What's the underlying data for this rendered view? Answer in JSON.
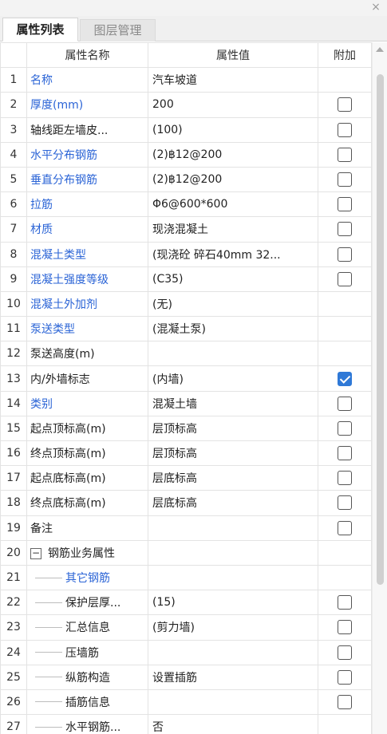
{
  "tabs": [
    {
      "label": "属性列表",
      "active": true
    },
    {
      "label": "图层管理",
      "active": false
    }
  ],
  "close_glyph": "×",
  "columns": {
    "name": "属性名称",
    "value": "属性值",
    "add": "附加"
  },
  "rows": [
    {
      "idx": "1",
      "name": "名称",
      "value": "汽车坡道",
      "blue": true,
      "checkbox": false,
      "checked": false
    },
    {
      "idx": "2",
      "name": "厚度(mm)",
      "value": "200",
      "blue": true,
      "checkbox": true,
      "checked": false
    },
    {
      "idx": "3",
      "name": "轴线距左墙皮...",
      "value": "(100)",
      "blue": false,
      "checkbox": true,
      "checked": false
    },
    {
      "idx": "4",
      "name": "水平分布钢筋",
      "value": "(2)฿12@200",
      "blue": true,
      "checkbox": true,
      "checked": false
    },
    {
      "idx": "5",
      "name": "垂直分布钢筋",
      "value": "(2)฿12@200",
      "blue": true,
      "checkbox": true,
      "checked": false
    },
    {
      "idx": "6",
      "name": "拉筋",
      "value": "Φ6@600*600",
      "blue": true,
      "checkbox": true,
      "checked": false
    },
    {
      "idx": "7",
      "name": "材质",
      "value": "现浇混凝土",
      "blue": true,
      "checkbox": true,
      "checked": false
    },
    {
      "idx": "8",
      "name": "混凝土类型",
      "value": "(现浇砼 碎石40mm 32...",
      "blue": true,
      "checkbox": true,
      "checked": false
    },
    {
      "idx": "9",
      "name": "混凝土强度等级",
      "value": "(C35)",
      "blue": true,
      "checkbox": true,
      "checked": false
    },
    {
      "idx": "10",
      "name": "混凝土外加剂",
      "value": "(无)",
      "blue": true,
      "checkbox": false,
      "checked": false
    },
    {
      "idx": "11",
      "name": "泵送类型",
      "value": "(混凝土泵)",
      "blue": true,
      "checkbox": false,
      "checked": false
    },
    {
      "idx": "12",
      "name": "泵送高度(m)",
      "value": "",
      "blue": false,
      "checkbox": false,
      "checked": false
    },
    {
      "idx": "13",
      "name": "内/外墙标志",
      "value": "(内墙)",
      "blue": false,
      "checkbox": true,
      "checked": true
    },
    {
      "idx": "14",
      "name": "类别",
      "value": "混凝土墙",
      "blue": true,
      "checkbox": true,
      "checked": false
    },
    {
      "idx": "15",
      "name": "起点顶标高(m)",
      "value": "层顶标高",
      "blue": false,
      "checkbox": true,
      "checked": false
    },
    {
      "idx": "16",
      "name": "终点顶标高(m)",
      "value": "层顶标高",
      "blue": false,
      "checkbox": true,
      "checked": false
    },
    {
      "idx": "17",
      "name": "起点底标高(m)",
      "value": "层底标高",
      "blue": false,
      "checkbox": true,
      "checked": false
    },
    {
      "idx": "18",
      "name": "终点底标高(m)",
      "value": "层底标高",
      "blue": false,
      "checkbox": true,
      "checked": false
    },
    {
      "idx": "19",
      "name": "备注",
      "value": "",
      "blue": false,
      "checkbox": true,
      "checked": false
    }
  ],
  "group": {
    "idx": "20",
    "toggle": "−",
    "name": "钢筋业务属性"
  },
  "child_rows": [
    {
      "idx": "21",
      "name": "其它钢筋",
      "value": "",
      "blue": true,
      "checkbox": false,
      "checked": false
    },
    {
      "idx": "22",
      "name": "保护层厚...",
      "value": "(15)",
      "blue": false,
      "checkbox": true,
      "checked": false
    },
    {
      "idx": "23",
      "name": "汇总信息",
      "value": "(剪力墙)",
      "blue": false,
      "checkbox": true,
      "checked": false
    },
    {
      "idx": "24",
      "name": "压墙筋",
      "value": "",
      "blue": false,
      "checkbox": true,
      "checked": false
    },
    {
      "idx": "25",
      "name": "纵筋构造",
      "value": "设置插筋",
      "blue": false,
      "checkbox": true,
      "checked": false
    },
    {
      "idx": "26",
      "name": "插筋信息",
      "value": "",
      "blue": false,
      "checkbox": true,
      "checked": false
    },
    {
      "idx": "27",
      "name": "水平钢筋...",
      "value": "否",
      "blue": false,
      "checkbox": false,
      "checked": false
    }
  ],
  "colors": {
    "blue_text": "#2b64d6",
    "checkbox_checked": "#2f79d7"
  }
}
